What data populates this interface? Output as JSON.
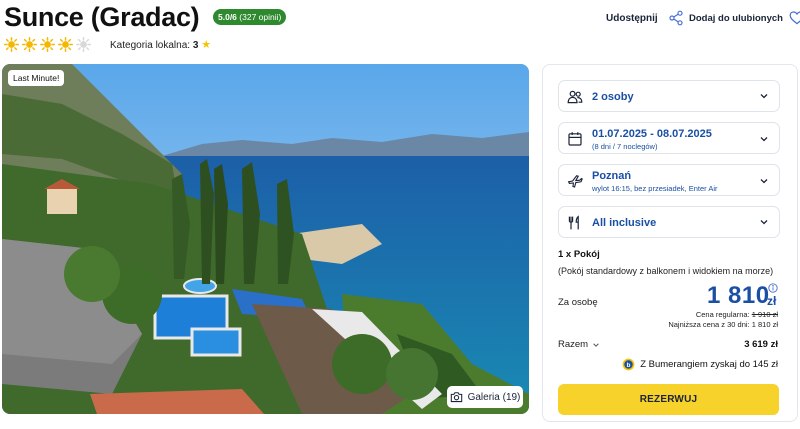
{
  "header": {
    "hotel_name": "Sunce (Gradac)",
    "rating_score": "5.0/6",
    "rating_count": "(327 opinii)",
    "sun_rating": 4,
    "sun_rating_max": 5,
    "local_category_label": "Kategoria lokalna:",
    "local_category_value": "3",
    "share_label": "Udostępnij",
    "favorite_label": "Dodaj do ulubionych"
  },
  "gallery": {
    "badge": "Last Minute!",
    "button_label": "Galeria (19)"
  },
  "booking": {
    "guests": {
      "label": "2 osoby",
      "icon": "people-icon"
    },
    "dates": {
      "label": "01.07.2025 - 08.07.2025",
      "sub": "(8 dni / 7 noclegów)",
      "icon": "calendar-icon"
    },
    "departure": {
      "label": "Poznań",
      "sub": "wylot 16:15, bez przesiadek, Enter Air",
      "icon": "plane-icon"
    },
    "board": {
      "label": "All inclusive",
      "icon": "cutlery-icon"
    },
    "room_count": "1 x Pokój",
    "room_desc": "(Pokój standardowy z balkonem i widokiem na morze)",
    "per_person_label": "Za osobę",
    "price_value": "1 810",
    "price_currency": "zł",
    "regular_price_label": "Cena regularna:",
    "regular_price_value": "1 910 zł",
    "lowest_price_label": "Najniższa cena z 30 dni:",
    "lowest_price_value": "1 810 zł",
    "total_label": "Razem",
    "total_value": "3 619 zł",
    "bumerang_text": "Z Bumerangiem zyskaj do 145 zł",
    "reserve_label": "REZERWUJ"
  },
  "colors": {
    "accent_blue": "#1a4fa3",
    "badge_green": "#2f8a2f",
    "reserve_yellow": "#f7d22b",
    "sun_yellow": "#f5c400"
  }
}
